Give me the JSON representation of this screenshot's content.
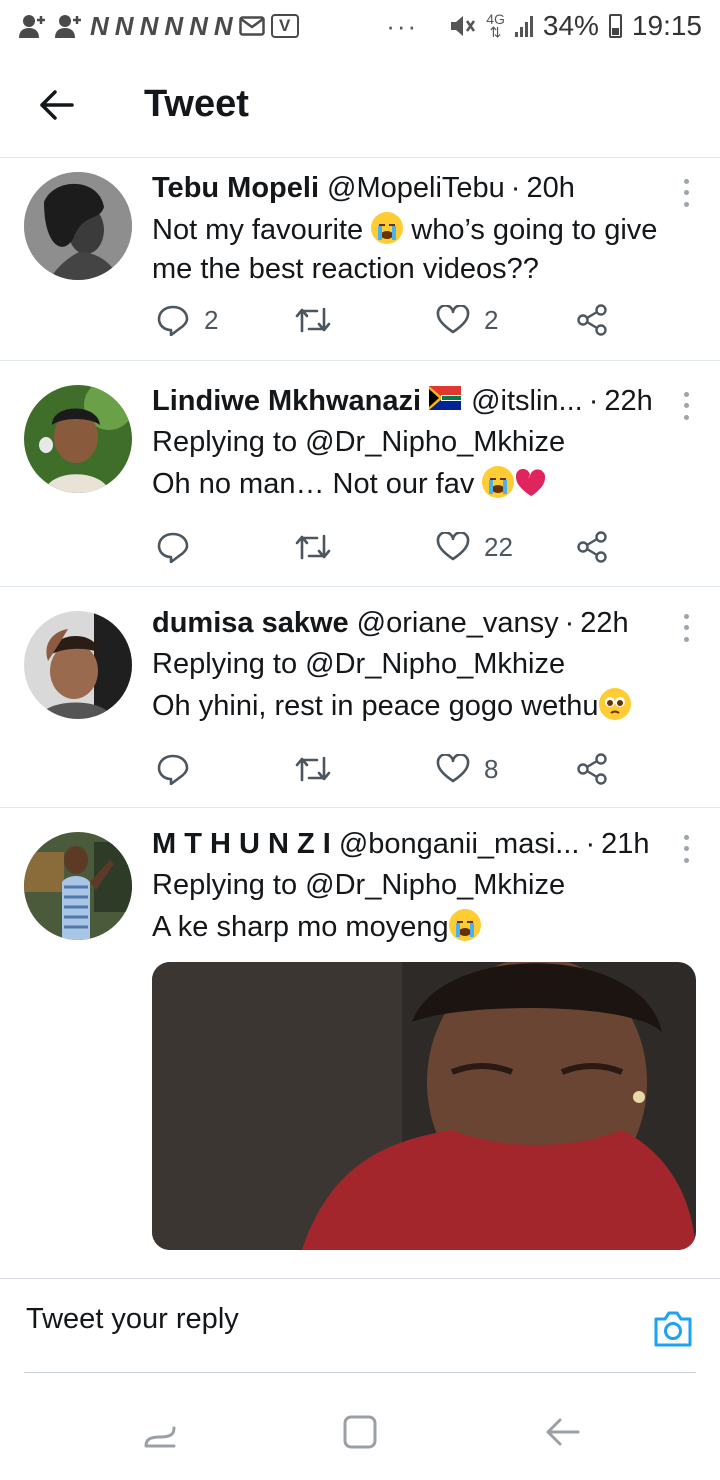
{
  "status_bar": {
    "notifications": [
      "N",
      "N",
      "N",
      "N",
      "N",
      "N"
    ],
    "v_badge": "V",
    "dots": "···",
    "network": "4G",
    "battery": "34%",
    "time": "19:15"
  },
  "header": {
    "title": "Tweet"
  },
  "tweets": [
    {
      "name": "Tebu Mopeli",
      "handle": "@MopeliTebu",
      "sep": "·",
      "time": "20h",
      "text_a": "Not my favourite",
      "text_b": " who’s going to give me the best reaction videos??",
      "replies": "2",
      "likes": "2"
    },
    {
      "name": "Lindiwe Mkhwanazi",
      "handle": "@itslin...",
      "sep": "·",
      "time": "22h",
      "replying": "Replying to ",
      "replying_handle": "@Dr_Nipho_Mkhize",
      "text": "Oh no man… Not our fav",
      "replies": "",
      "likes": "22"
    },
    {
      "name": "dumisa sakwe",
      "handle": "@oriane_vansy",
      "sep": "·",
      "time": "22h",
      "replying": "Replying to ",
      "replying_handle": "@Dr_Nipho_Mkhize",
      "text": "Oh yhini, rest in peace gogo wethu",
      "replies": "",
      "likes": "8"
    },
    {
      "name": "M T H U N Z I",
      "handle": "@bonganii_masi...",
      "sep": "·",
      "time": "21h",
      "replying": "Replying to ",
      "replying_handle": "@Dr_Nipho_Mkhize",
      "text": "A ke sharp mo moyeng"
    }
  ],
  "reply_bar": {
    "placeholder": "Tweet your reply"
  },
  "colors": {
    "accent": "#1da1f2",
    "text": "#14171a",
    "icon": "#4a5761",
    "divider": "#e1e8ed"
  },
  "icons": [
    "back-arrow-icon",
    "more-icon",
    "reply-icon",
    "retweet-icon",
    "like-icon",
    "share-icon",
    "camera-icon",
    "recents-icon",
    "home-icon",
    "back-nav-icon"
  ]
}
